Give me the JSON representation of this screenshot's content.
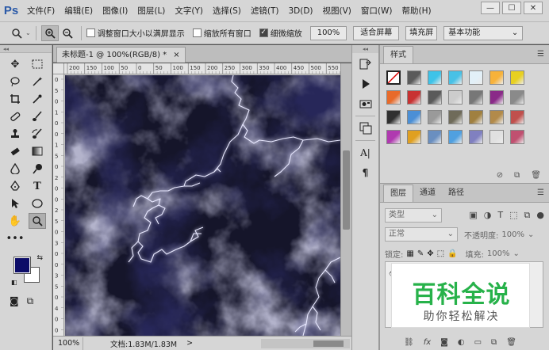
{
  "app": {
    "logo": "Ps"
  },
  "menu": [
    "文件(F)",
    "编辑(E)",
    "图像(I)",
    "图层(L)",
    "文字(Y)",
    "选择(S)",
    "滤镜(T)",
    "3D(D)",
    "视图(V)",
    "窗口(W)",
    "帮助(H)"
  ],
  "window_controls": {
    "minimize": "—",
    "restore": "☐",
    "close": "✕"
  },
  "options": {
    "tool_icon": "zoom-icon",
    "resize_windows": "调整窗口大小以满屏显示",
    "resize_windows_checked": false,
    "zoom_all": "缩放所有窗口",
    "zoom_all_checked": false,
    "scrubby_zoom": "细微缩放",
    "scrubby_zoom_checked": true,
    "btn_100": "100%",
    "btn_fit": "适合屏幕",
    "btn_fill": "填充屏",
    "workspace": "基本功能"
  },
  "document": {
    "tab_title": "未标题-1 @ 100%(RGB/8) *",
    "tab_close": "×",
    "ruler_h": [
      "200",
      "150",
      "100",
      "50",
      "0",
      "50",
      "100",
      "150",
      "200",
      "250",
      "300",
      "350",
      "400",
      "450",
      "500",
      "550"
    ],
    "ruler_v": [
      "0",
      "5",
      "0",
      "1",
      "0",
      "0",
      "1",
      "5",
      "0",
      "2",
      "0",
      "0",
      "2",
      "5",
      "0",
      "3",
      "0",
      "0",
      "3",
      "5",
      "0",
      "4",
      "0",
      "0"
    ]
  },
  "status": {
    "zoom": "100%",
    "doc_info": "文档:1.83M/1.83M",
    "arrow": ">"
  },
  "styles_panel": {
    "tab": "样式",
    "swatch_colors": [
      "#ffffff",
      "#5a5a5a",
      "#3ec3e8",
      "#48c1e6",
      "#e2f0f8",
      "#f7b23a",
      "#e8d020",
      "#e86a2a",
      "#c83232",
      "#5a5a5a",
      "#cccccc",
      "#777777",
      "#8a2a88",
      "#8a8a8a",
      "#303030",
      "#4b8fd6",
      "#9a9a9a",
      "#6f6b5a",
      "#a08040",
      "#b28a4a",
      "#c0504d",
      "#b03ab0",
      "#e0a020",
      "#6a8fc0",
      "#50a0e0",
      "#8080c0",
      "#e0e0e0",
      "#c05070"
    ]
  },
  "layers_panel": {
    "tabs": [
      "图层",
      "通道",
      "路径"
    ],
    "active_tab": "图层",
    "filter_placeholder": "类型",
    "blend_mode": "正常",
    "opacity_label": "不透明度:",
    "opacity": "100%",
    "lock_label": "锁定:",
    "fill_label": "填充:",
    "fill": "100%"
  },
  "watermark": {
    "title": "百科全说",
    "subtitle": "助你轻松解决"
  }
}
